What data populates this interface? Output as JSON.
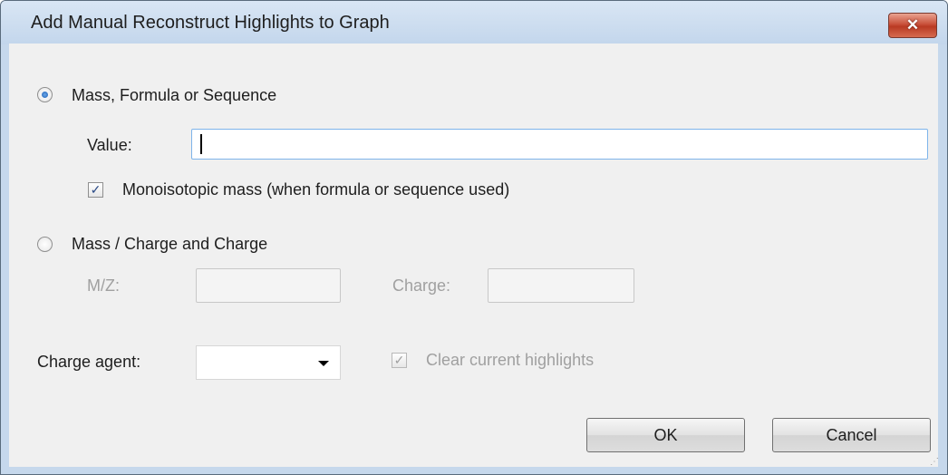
{
  "window": {
    "title": "Add Manual Reconstruct Highlights to Graph",
    "close_label": "✕"
  },
  "mass_section": {
    "radio_label": "Mass, Formula or Sequence",
    "value_label": "Value:",
    "value": "",
    "monoisotopic_label": "Monoisotopic mass (when formula or sequence used)",
    "monoisotopic_checked": true
  },
  "mz_section": {
    "radio_label": "Mass / Charge and Charge",
    "mz_label": "M/Z:",
    "mz_value": "",
    "charge_label": "Charge:",
    "charge_value": ""
  },
  "charge_agent": {
    "label": "Charge agent:",
    "selected": ""
  },
  "clear_highlights": {
    "label": "Clear current highlights",
    "checked": true
  },
  "buttons": {
    "ok": "OK",
    "cancel": "Cancel"
  }
}
